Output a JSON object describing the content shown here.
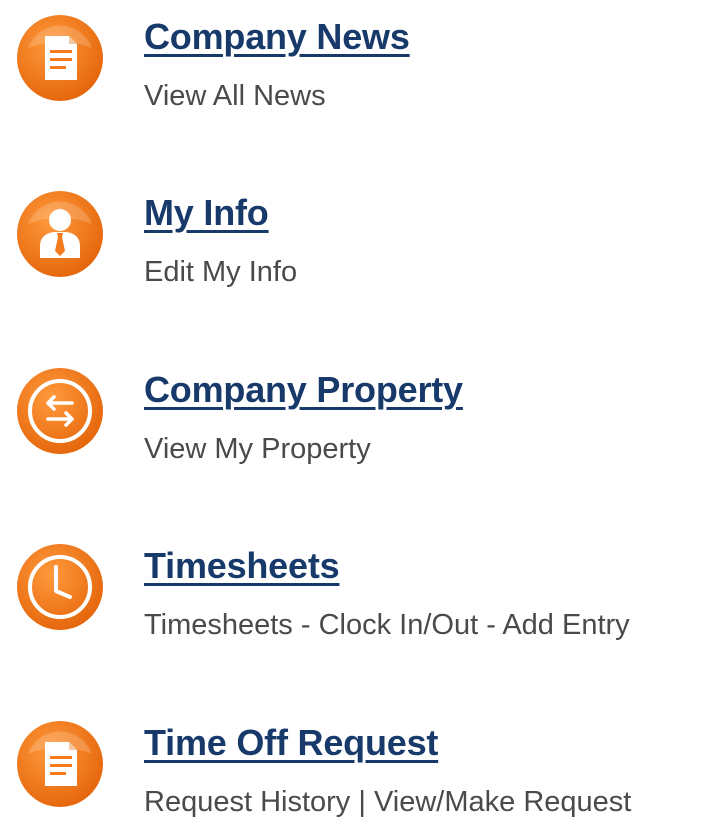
{
  "colors": {
    "icon_orange": "#f47a1f",
    "icon_orange_dark": "#e4640a",
    "title": "#173a6b",
    "subtitle": "#4a4a4a"
  },
  "items": [
    {
      "icon": "document-icon",
      "title": "Company News",
      "links": [
        "View All News"
      ]
    },
    {
      "icon": "user-icon",
      "title": "My Info",
      "links": [
        "Edit My Info"
      ]
    },
    {
      "icon": "exchange-arrows-icon",
      "title": "Company Property",
      "links": [
        "View My Property"
      ]
    },
    {
      "icon": "clock-icon",
      "title": "Timesheets",
      "links": [
        "Timesheets",
        "Clock In/Out",
        "Add Entry"
      ],
      "separator": " - "
    },
    {
      "icon": "document-icon",
      "title": "Time Off Request",
      "links": [
        "Request History",
        "View/Make Request"
      ],
      "separator": " | "
    }
  ]
}
